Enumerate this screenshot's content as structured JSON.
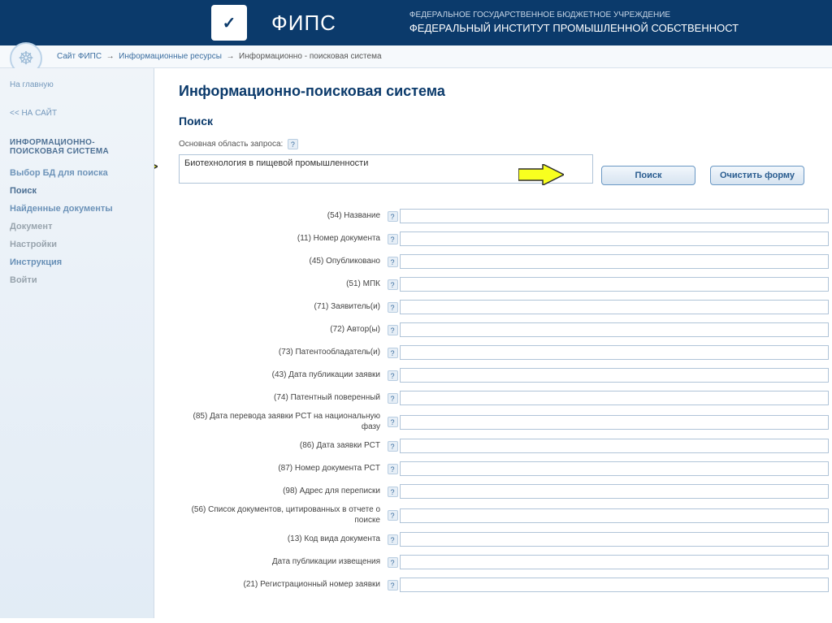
{
  "header": {
    "title": "ФИПС",
    "line1": "ФЕДЕРАЛЬНОЕ ГОСУДАРСТВЕННОЕ БЮДЖЕТНОЕ УЧРЕЖДЕНИЕ",
    "line2": "ФЕДЕРАЛЬНЫЙ ИНСТИТУТ ПРОМЫШЛЕННОЙ СОБСТВЕННОСТ"
  },
  "breadcrumb": {
    "a": "Сайт ФИПС",
    "b": "Информационные ресурсы",
    "c": "Информационно - поисковая система"
  },
  "sidebar": {
    "home": "На главную",
    "back": "<< НА САЙТ",
    "header": "ИНФОРМАЦИОННО-ПОИСКОВАЯ СИСТЕМА",
    "items": [
      {
        "label": "Выбор БД для поиска"
      },
      {
        "label": "Поиск"
      },
      {
        "label": "Найденные документы"
      },
      {
        "label": "Документ"
      },
      {
        "label": "Настройки"
      },
      {
        "label": "Инструкция"
      },
      {
        "label": "Войти"
      }
    ]
  },
  "page": {
    "title": "Информационно-поисковая система",
    "search_heading": "Поиск",
    "main_label": "Основная область запроса:",
    "main_value": "Биотехнология в пищевой промышленности",
    "btn_search": "Поиск",
    "btn_clear": "Очистить форму"
  },
  "fields": [
    "(54) Название",
    "(11) Номер документа",
    "(45) Опубликовано",
    "(51) МПК",
    "(71) Заявитель(и)",
    "(72) Автор(ы)",
    "(73) Патентообладатель(и)",
    "(43) Дата публикации заявки",
    "(74) Патентный поверенный",
    "(85) Дата перевода заявки PCT на национальную фазу",
    "(86) Дата заявки PCT",
    "(87) Номер документа PCT",
    "(98) Адрес для переписки",
    "(56) Список документов, цитированных в отчете о поиске",
    "(13) Код вида документа",
    "Дата публикации извещения",
    "(21) Регистрационный номер заявки"
  ]
}
